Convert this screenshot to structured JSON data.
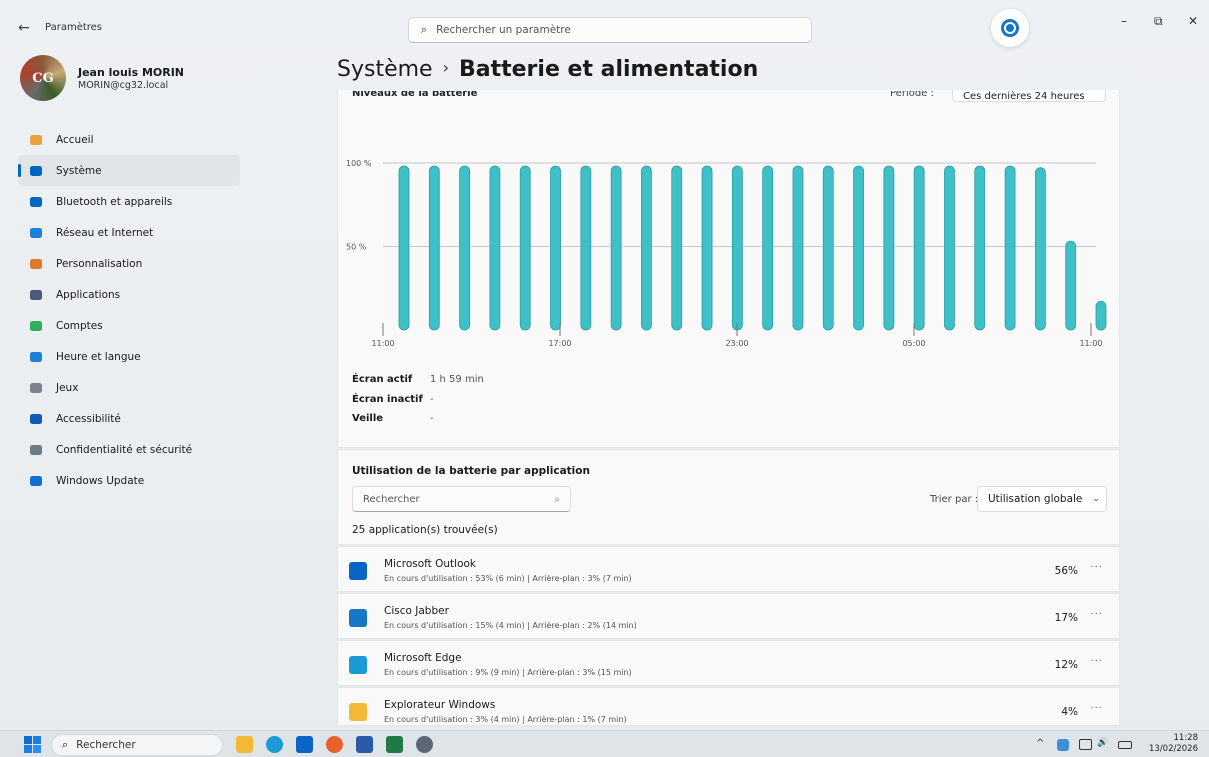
{
  "window": {
    "title": "Paramètres",
    "back_glyph": "←",
    "search_placeholder": "Rechercher un paramètre",
    "controls": {
      "minimize": "–",
      "maximize": "⧉",
      "close": "✕"
    }
  },
  "profile": {
    "name": "Jean louis MORIN",
    "email": "MORIN@cg32.local",
    "avatar_text": "CG"
  },
  "nav": [
    {
      "label": "Accueil",
      "icon": "home-icon",
      "color": "#e8a33c"
    },
    {
      "label": "Système",
      "icon": "system-icon",
      "color": "#0067c0",
      "active": true
    },
    {
      "label": "Bluetooth et appareils",
      "icon": "bluetooth-icon",
      "color": "#0067c0"
    },
    {
      "label": "Réseau et Internet",
      "icon": "wifi-icon",
      "color": "#1f7fd8"
    },
    {
      "label": "Personnalisation",
      "icon": "brush-icon",
      "color": "#e07a2a"
    },
    {
      "label": "Applications",
      "icon": "apps-icon",
      "color": "#4a5a78"
    },
    {
      "label": "Comptes",
      "icon": "account-icon",
      "color": "#2fae5b"
    },
    {
      "label": "Heure et langue",
      "icon": "globe-clock-icon",
      "color": "#1f7fd8"
    },
    {
      "label": "Jeux",
      "icon": "gamepad-icon",
      "color": "#7a8490"
    },
    {
      "label": "Accessibilité",
      "icon": "accessibility-icon",
      "color": "#0f5bb5"
    },
    {
      "label": "Confidentialité et sécurité",
      "icon": "shield-icon",
      "color": "#6d7a86"
    },
    {
      "label": "Windows Update",
      "icon": "windows-update-icon",
      "color": "#0f6fd0"
    }
  ],
  "breadcrumb": {
    "parent": "Système",
    "separator": "›",
    "current": "Batterie et alimentation"
  },
  "battery_card": {
    "title": "Niveaux de la batterie",
    "period_label": "Période :",
    "period_value": "Ces dernières 24 heures",
    "chevron": "⌄",
    "stats": [
      {
        "label": "Écran actif",
        "value": "1 h 59 min"
      },
      {
        "label": "Écran inactif",
        "value": "-"
      },
      {
        "label": "Veille",
        "value": "-"
      }
    ]
  },
  "chart_data": {
    "type": "bar",
    "x_labels": [
      "11:00",
      "17:00",
      "23:00",
      "05:00",
      "11:00"
    ],
    "y_ticks": [
      "100 %",
      "50 %"
    ],
    "ylim": [
      0,
      100
    ],
    "values": [
      100,
      100,
      100,
      100,
      100,
      100,
      100,
      100,
      100,
      100,
      100,
      100,
      100,
      100,
      100,
      100,
      100,
      100,
      100,
      100,
      100,
      99,
      55,
      19
    ],
    "bar_color": "#3fc0c6",
    "grid": true
  },
  "apps_card": {
    "title": "Utilisation de la batterie par application",
    "search_placeholder": "Rechercher",
    "sort_label": "Trier par :",
    "sort_value": "Utilisation globale",
    "count_text": "25 application(s) trouvée(s)"
  },
  "apps": [
    {
      "name": "Microsoft Outlook",
      "detail": "En cours d'utilisation : 53% (6 min) | Arrière-plan : 3% (7 min)",
      "percent": "56%",
      "icon": "outlook-icon",
      "color": "#0a64c4",
      "glyph": "o"
    },
    {
      "name": "Cisco Jabber",
      "detail": "En cours d'utilisation : 15% (4 min) | Arrière-plan : 2% (14 min)",
      "percent": "17%",
      "icon": "jabber-icon",
      "color": "#1677c6",
      "glyph": "◉"
    },
    {
      "name": "Microsoft Edge",
      "detail": "En cours d'utilisation : 9% (9 min) | Arrière-plan : 3% (15 min)",
      "percent": "12%",
      "icon": "edge-icon",
      "color": "#1b9ad6",
      "glyph": "e"
    },
    {
      "name": "Explorateur Windows",
      "detail": "En cours d'utilisation : 3% (4 min) | Arrière-plan : 1% (7 min)",
      "percent": "4%",
      "icon": "folder-icon",
      "color": "#f2b935",
      "glyph": "▬"
    }
  ],
  "more_glyph": "···",
  "taskbar": {
    "search_placeholder": "Rechercher",
    "apps": [
      {
        "icon": "file-explorer-icon",
        "color": "#f2b935"
      },
      {
        "icon": "edge-icon",
        "color": "#1b9ad6"
      },
      {
        "icon": "outlook-icon",
        "color": "#0a64c4"
      },
      {
        "icon": "firefox-icon",
        "color": "#e8612c"
      },
      {
        "icon": "word-icon",
        "color": "#2b5aa8"
      },
      {
        "icon": "excel-icon",
        "color": "#1f7a45"
      },
      {
        "icon": "settings-icon",
        "color": "#5b6874"
      }
    ],
    "tray": {
      "chevron": "^",
      "speaker": "🔊",
      "time": "11:28",
      "date": "13/02/2026"
    }
  }
}
